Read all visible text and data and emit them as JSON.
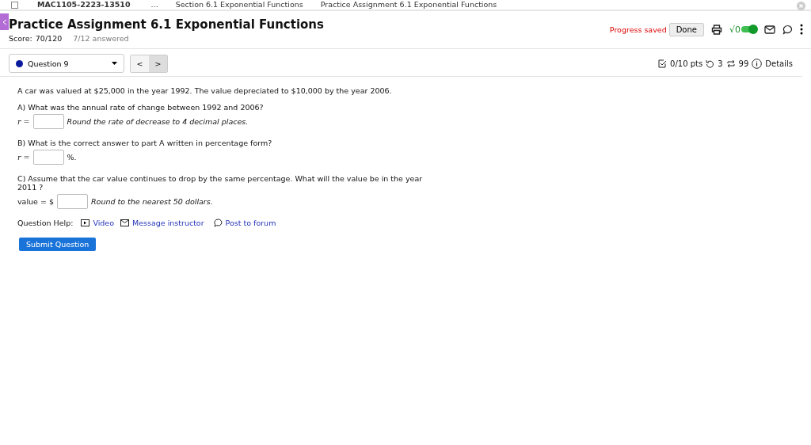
{
  "breadcrumbs": [
    "MAC1105-2223-13510",
    "...",
    "Section 6.1 Exponential Functions",
    "Practice Assignment 6.1 Exponential Functions"
  ],
  "header": {
    "title": "Practice Assignment 6.1 Exponential Functions",
    "score_label": "Score:",
    "score": "70/120",
    "answered": "7/12 answered",
    "status": "Progress saved",
    "done_button": "Done",
    "math_toggle": {
      "label": "√0",
      "on": true
    }
  },
  "question_bar": {
    "question_select": {
      "label": "Question 9",
      "color": "#0a1a9c"
    },
    "prev": "<",
    "next": ">",
    "points": "0/10 pts",
    "attempts": "3",
    "retries": "99",
    "details": "Details"
  },
  "problem": {
    "intro": "A car was valued at $25,000 in the year 1992. The value depreciated to $10,000 by the year 2006.",
    "parts": [
      {
        "prompt": "A) What was the annual rate of change between 1992 and 2006?",
        "variable": "r =",
        "hint": "Round the rate of decrease to 4 decimal places."
      },
      {
        "prompt": "B) What is the correct answer to part A written in percentage form?",
        "variable": "r =",
        "suffix": "%."
      },
      {
        "prompt": "C) Assume that the car value continues to drop by the same percentage. What will the value be in the year 2011 ?",
        "variable": "value = $",
        "hint": "Round to the nearest 50 dollars."
      }
    ]
  },
  "help": {
    "label": "Question Help:",
    "links": [
      {
        "kind": "video",
        "label": "Video"
      },
      {
        "kind": "message",
        "label": "Message instructor"
      },
      {
        "kind": "forum",
        "label": "Post to forum"
      }
    ]
  },
  "submit_button": "Submit Question"
}
